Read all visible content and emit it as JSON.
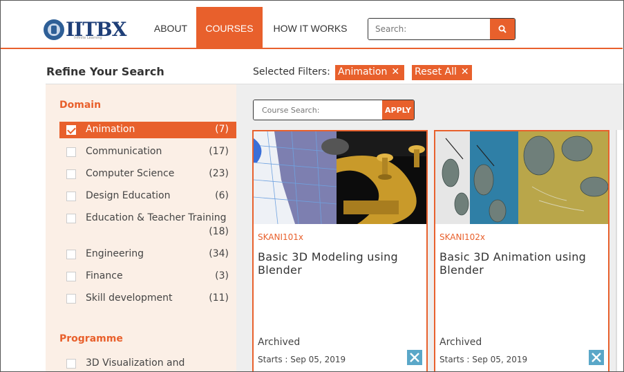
{
  "header": {
    "logo_text": "IITBX",
    "logo_tagline": "Infinite Learning",
    "nav": [
      {
        "label": "ABOUT"
      },
      {
        "label": "COURSES"
      },
      {
        "label": "HOW IT WORKS"
      }
    ],
    "search_placeholder": "Search:",
    "accent_color": "#e8602c"
  },
  "sidebar": {
    "title": "Refine Your Search",
    "domain_title": "Domain",
    "domain_items": [
      {
        "label": "Animation",
        "count": "(7)",
        "checked": true
      },
      {
        "label": "Communication",
        "count": "(17)"
      },
      {
        "label": "Computer Science",
        "count": "(23)"
      },
      {
        "label": "Design Education",
        "count": "(6)"
      },
      {
        "label": "Education & Teacher Training",
        "count": "(18)"
      },
      {
        "label": "Engineering",
        "count": "(34)"
      },
      {
        "label": "Finance",
        "count": "(3)"
      },
      {
        "label": "Skill development",
        "count": "(11)"
      }
    ],
    "programme_title": "Programme",
    "programme_items": [
      {
        "label": "3D Visualization and"
      }
    ]
  },
  "filters": {
    "label": "Selected Filters:",
    "chips": [
      {
        "label": "Animation"
      },
      {
        "label": "Reset All"
      }
    ]
  },
  "course_search": {
    "placeholder": "Course Search:",
    "apply_label": "APPLY"
  },
  "courses": [
    {
      "code": "SKANI101x",
      "title": "Basic 3D Modeling using Blender",
      "status": "Archived",
      "start": "Starts : Sep 05, 2019"
    },
    {
      "code": "SKANI102x",
      "title": "Basic 3D Animation using Blender",
      "status": "Archived",
      "start": "Starts : Sep 05, 2019"
    }
  ]
}
